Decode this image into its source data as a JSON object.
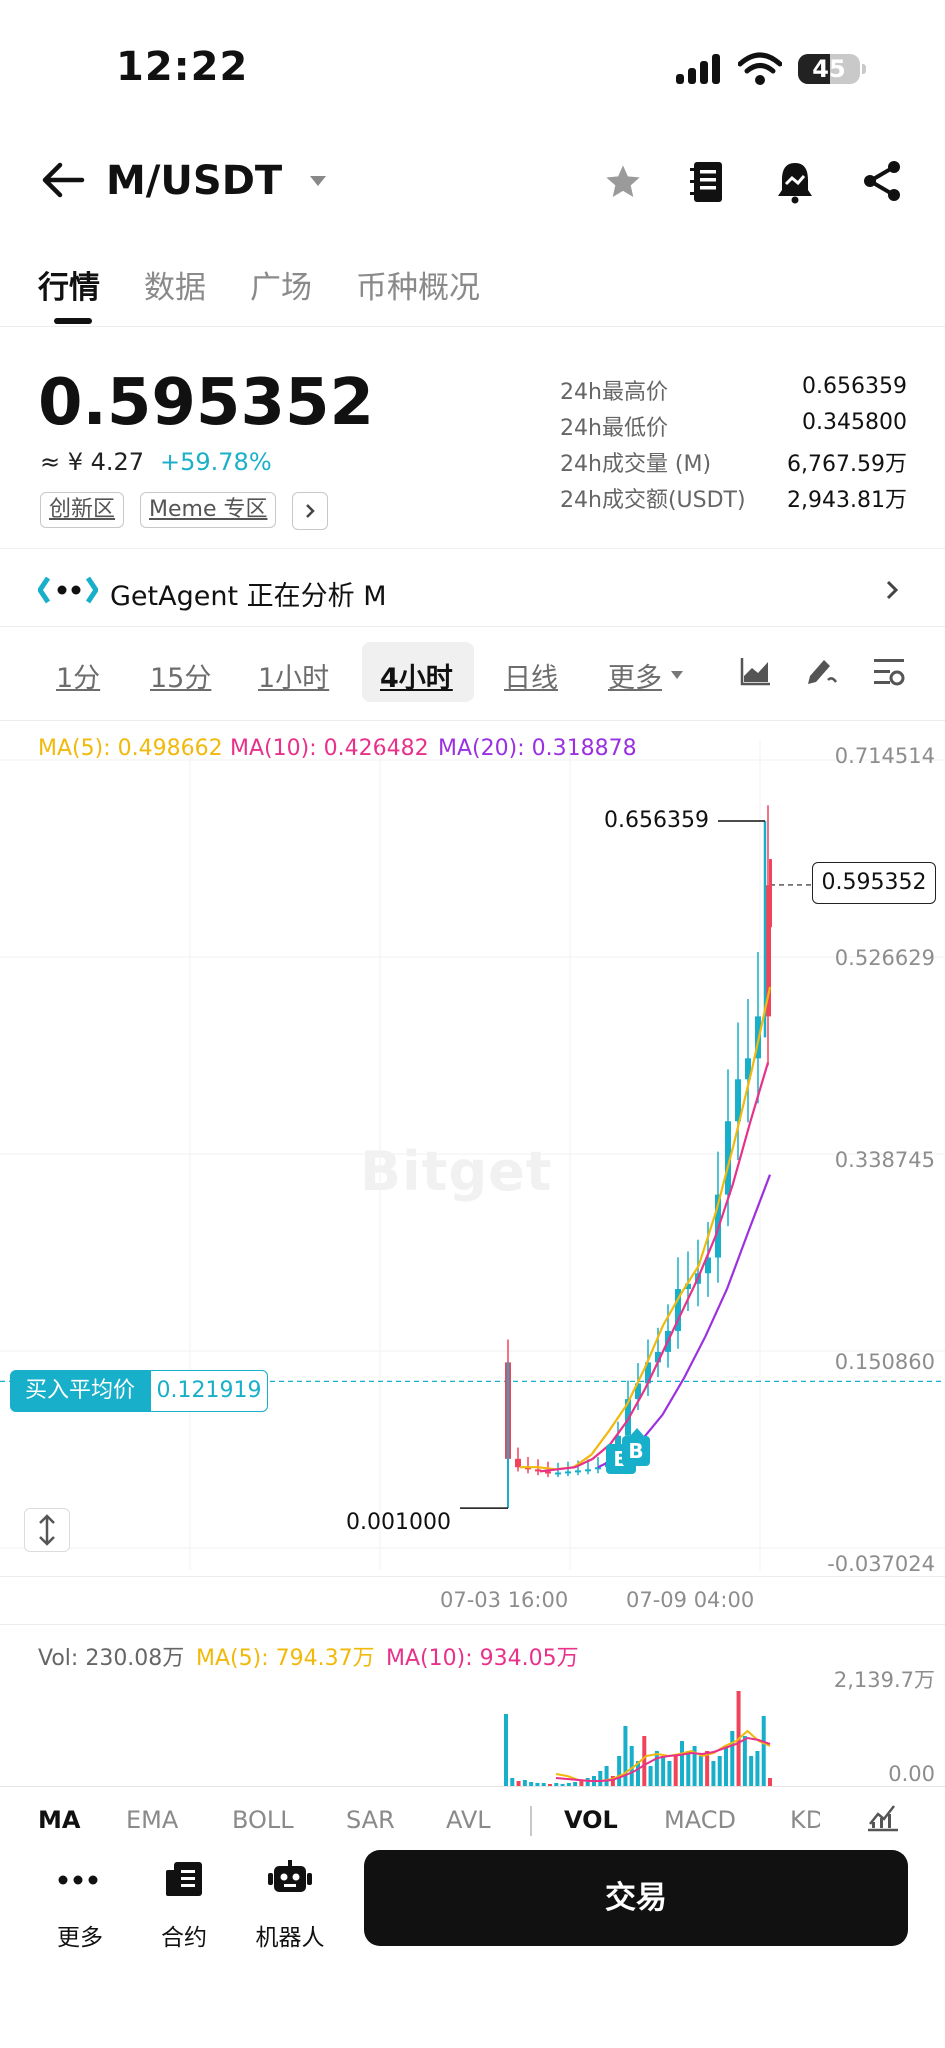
{
  "status_bar": {
    "time": "12:22",
    "battery": "45"
  },
  "header": {
    "pair": "M/USDT"
  },
  "tabs": [
    "行情",
    "数据",
    "广场",
    "币种概况"
  ],
  "ticker": {
    "price": "0.595352",
    "cny": "≈ ¥ 4.27",
    "change": "+59.78%",
    "tags": [
      "创新区",
      "Meme 专区"
    ],
    "stats": [
      {
        "label": "24h最高价",
        "value": "0.656359"
      },
      {
        "label": "24h最低价",
        "value": "0.345800"
      },
      {
        "label": "24h成交量 (M)",
        "value": "6,767.59万"
      },
      {
        "label": "24h成交额(USDT)",
        "value": "2,943.81万"
      }
    ]
  },
  "agent": {
    "text": "GetAgent 正在分析 M"
  },
  "intervals": [
    "1分",
    "15分",
    "1小时",
    "4小时",
    "日线",
    "更多"
  ],
  "active_interval": "4小时",
  "ma_legend": [
    {
      "text": "MA(5): 0.498662",
      "color": "#f0b90b"
    },
    {
      "text": "MA(10): 0.426482",
      "color": "#e8318a"
    },
    {
      "text": "MA(20): 0.318878",
      "color": "#9b30e0"
    }
  ],
  "chart": {
    "y_axis": [
      "0.714514",
      "0.526629",
      "0.338745",
      "0.150860",
      "-0.037024"
    ],
    "current_price": "0.595352",
    "high_label": "0.656359",
    "low_label": "0.001000",
    "avg_label": "买入平均价",
    "avg_value": "0.121919",
    "x_axis": [
      "07-03 16:00",
      "07-09 04:00"
    ],
    "watermark": "Bitget",
    "marker": "B"
  },
  "volume": {
    "legend": [
      {
        "text": "Vol: 230.08万",
        "color": "#666666"
      },
      {
        "text": "MA(5): 794.37万",
        "color": "#f0b90b"
      },
      {
        "text": "MA(10): 934.05万",
        "color": "#e8318a"
      }
    ],
    "y_axis": [
      "2,139.7万",
      "0.00"
    ]
  },
  "indicators": [
    "MA",
    "EMA",
    "BOLL",
    "SAR",
    "AVL",
    "VOL",
    "MACD",
    "KD"
  ],
  "bottom": {
    "more": "更多",
    "contract": "合约",
    "bot": "机器人",
    "trade": "交易"
  },
  "colors": {
    "up": "#17afc9",
    "down": "#f0445a",
    "accent": "#17afc9"
  },
  "chart_data": {
    "type": "candlestick",
    "interval": "4小时",
    "ylim": [
      -0.037024,
      0.714514
    ],
    "y_ticks": [
      0.714514,
      0.526629,
      0.338745,
      0.15086,
      -0.037024
    ],
    "x_ticks": [
      "07-03 16:00",
      "07-09 04:00"
    ],
    "high": 0.656359,
    "low": 0.001,
    "last": 0.595352,
    "avg_buy": 0.121919,
    "closes": [
      0.048,
      0.04,
      0.038,
      0.036,
      0.034,
      0.035,
      0.036,
      0.037,
      0.038,
      0.04,
      0.045,
      0.07,
      0.105,
      0.12,
      0.14,
      0.15,
      0.17,
      0.21,
      0.215,
      0.225,
      0.24,
      0.3,
      0.37,
      0.41,
      0.43,
      0.47,
      0.595
    ],
    "series": [
      {
        "name": "MA(5)",
        "values": [
          0.04,
          0.04,
          0.038,
          0.04,
          0.052,
          0.075,
          0.1,
          0.135,
          0.175,
          0.205,
          0.232,
          0.285,
          0.35,
          0.42,
          0.498
        ]
      },
      {
        "name": "MA(10)",
        "values": [
          0.036,
          0.038,
          0.04,
          0.048,
          0.062,
          0.085,
          0.115,
          0.15,
          0.185,
          0.22,
          0.26,
          0.31,
          0.37,
          0.426
        ]
      },
      {
        "name": "MA(20)",
        "values": [
          0.04,
          0.05,
          0.065,
          0.09,
          0.125,
          0.165,
          0.21,
          0.265,
          0.319
        ]
      }
    ]
  }
}
